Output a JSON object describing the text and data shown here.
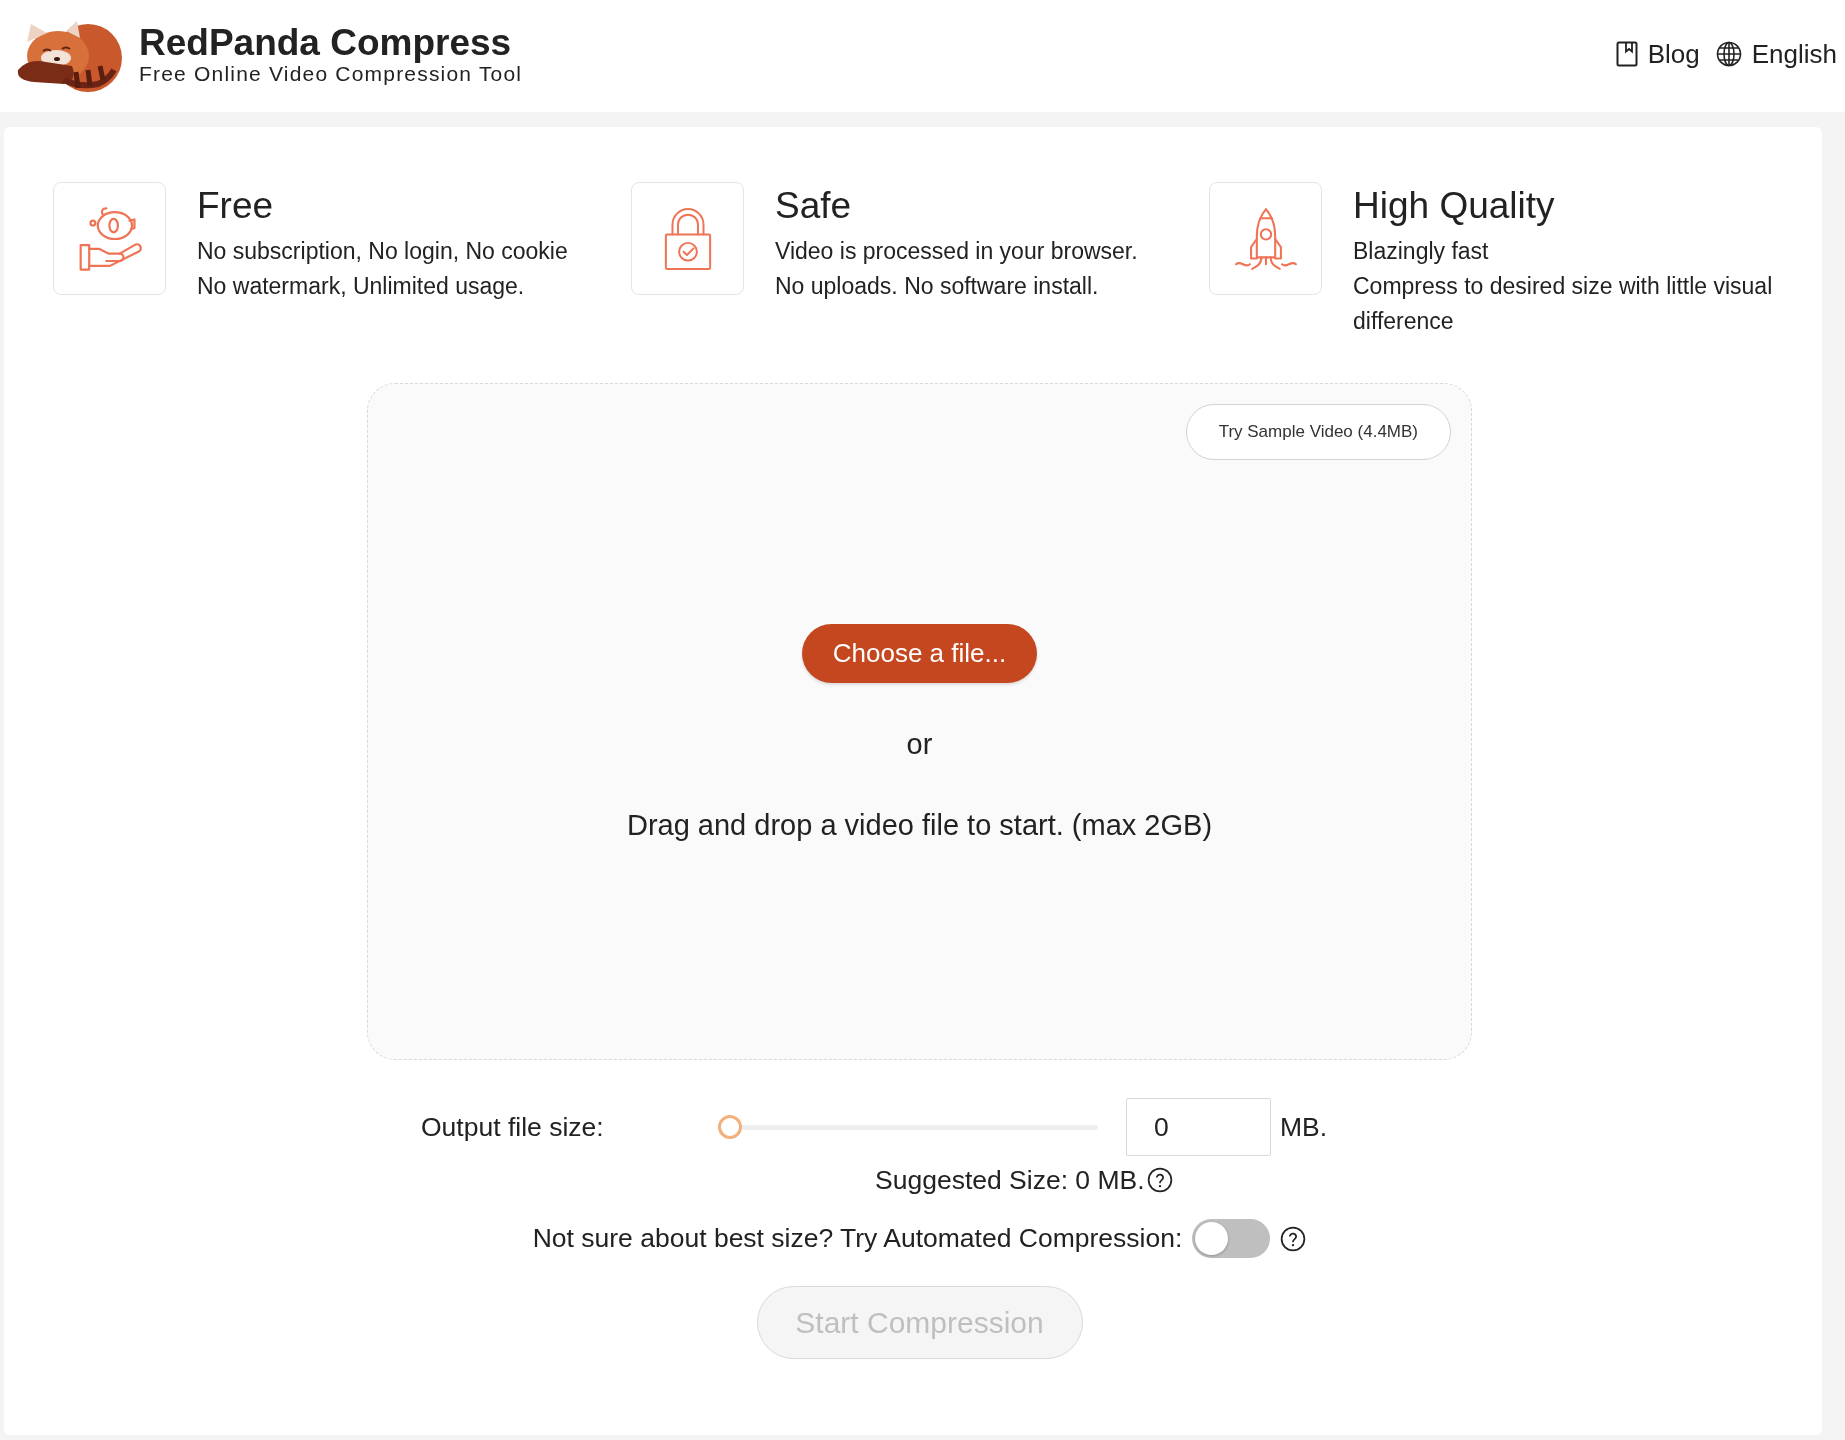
{
  "header": {
    "title": "RedPanda Compress",
    "subtitle": "Free Online Video Compression Tool",
    "nav": [
      {
        "kind": "blog",
        "label": "Blog"
      },
      {
        "kind": "language",
        "label": "English"
      }
    ]
  },
  "features": [
    {
      "kind": "savings",
      "title": "Free",
      "lines": [
        "No subscription, No login, No cookie",
        "No watermark, Unlimited usage."
      ]
    },
    {
      "kind": "security",
      "title": "Safe",
      "lines": [
        "Video is processed in your browser.",
        "No uploads. No software install."
      ]
    },
    {
      "kind": "speed",
      "title": "High Quality",
      "lines": [
        "Blazingly fast",
        "Compress to desired size with little visual difference"
      ]
    }
  ],
  "dropzone": {
    "sample_button": "Try Sample Video (4.4MB)",
    "choose_button": "Choose a file...",
    "separator": "or",
    "hint": "Drag and drop a video file to start. (max 2GB)"
  },
  "output_size": {
    "label": "Output file size:",
    "level": 0,
    "value": "0",
    "unit": "MB.",
    "suggested": "Suggested Size: 0 MB."
  },
  "automated": {
    "label": "Not sure about best size? Try Automated Compression:",
    "on": false
  },
  "start_button": {
    "label": "Start Compression",
    "disabled": true
  }
}
